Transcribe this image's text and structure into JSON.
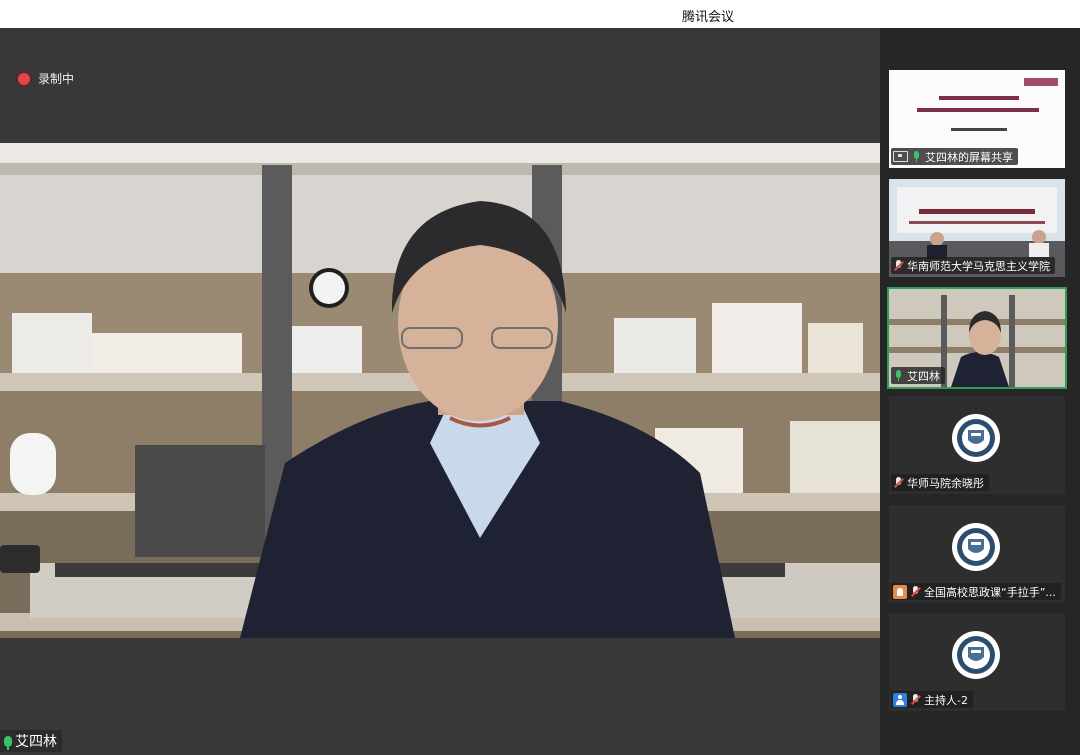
{
  "app": {
    "title": "腾讯会议"
  },
  "recording": {
    "label": "录制中"
  },
  "main_video": {
    "speaker_name": "艾四林"
  },
  "participants": [
    {
      "name": "艾四林的屏幕共享",
      "type": "screen-share"
    },
    {
      "name": "华南师范大学马克思主义学院",
      "type": "video",
      "muted": true
    },
    {
      "name": "艾四林",
      "type": "video",
      "muted": false,
      "active_speaker": true
    },
    {
      "name": "华师马院余晓彤",
      "type": "avatar",
      "muted": true
    },
    {
      "name": "全国高校思政课“手拉手”...",
      "type": "avatar",
      "muted": true,
      "badge": "hand-raise"
    },
    {
      "name": "主持人-2",
      "type": "avatar",
      "muted": true,
      "badge": "host"
    }
  ],
  "colors": {
    "recording_dot": "#e2464a",
    "active_border": "#2f9e56",
    "mic_on": "#3cc06a",
    "host_badge": "#2f7fe0",
    "hand_badge": "#e8894a"
  }
}
